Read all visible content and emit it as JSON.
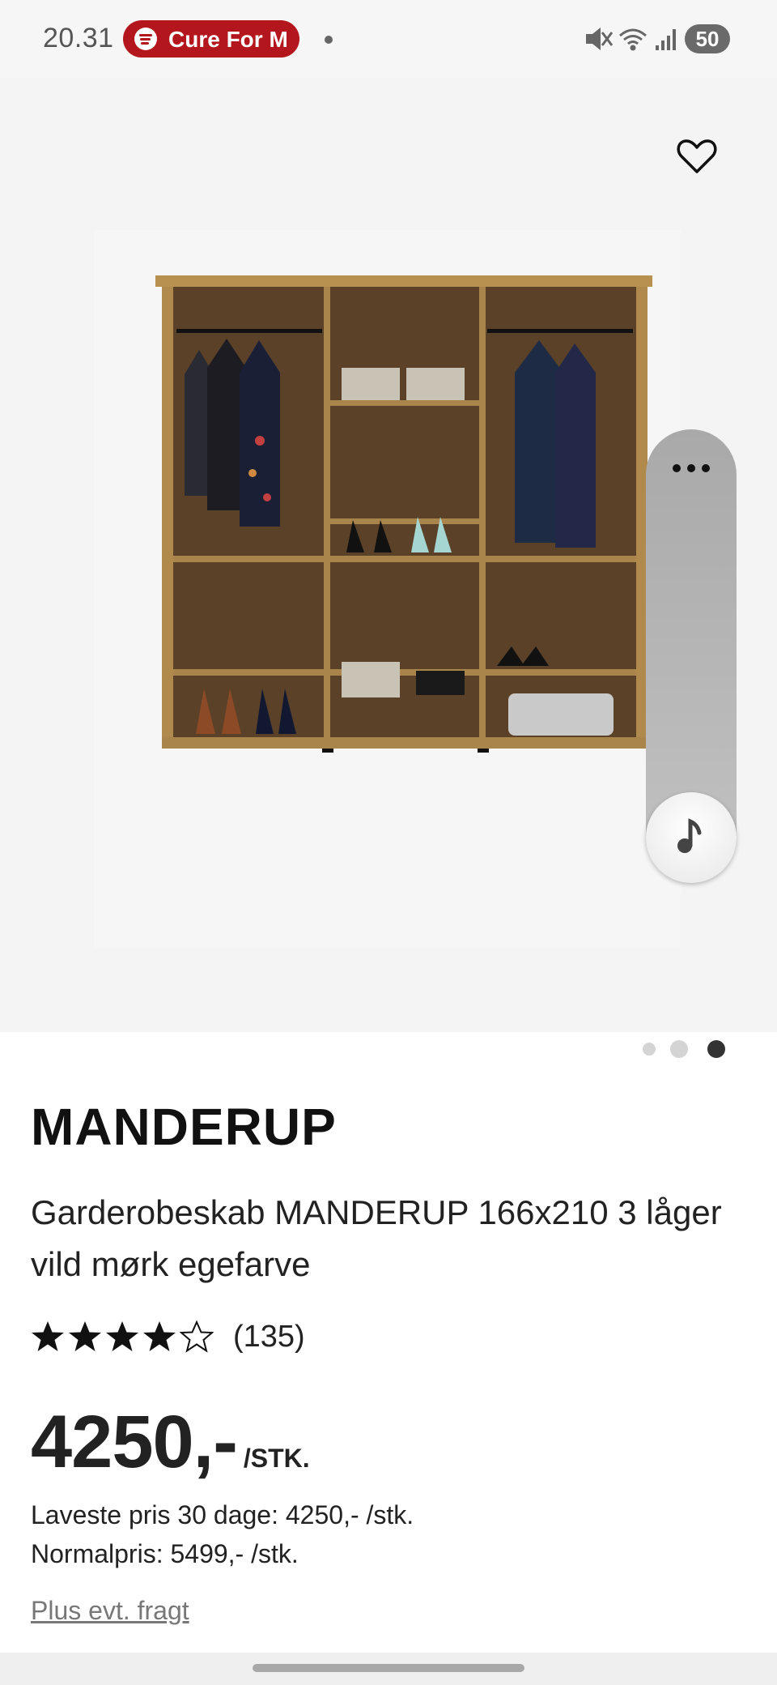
{
  "status_bar": {
    "time": "20.31",
    "media_app": "Spotify",
    "media_title": "Cure For M",
    "battery": "50",
    "icons": [
      "mute-icon",
      "wifi-icon",
      "signal-icon",
      "battery-icon"
    ]
  },
  "gallery": {
    "wishlist_icon": "heart-outline-icon",
    "image_subject": "wardrobe",
    "slide_count": 3,
    "active_slide": 3
  },
  "floating_widget": {
    "more_icon": "more-horizontal-icon",
    "music_icon": "music-note-icon"
  },
  "product": {
    "brand": "MANDERUP",
    "description": "Garderobeskab MANDERUP 166x210 3 låger vild mørk egefarve",
    "rating": 4,
    "rating_max": 5,
    "review_count": "(135)",
    "price": "4250,-",
    "price_unit": "/STK.",
    "lowest_price": "Laveste pris 30 dage: 4250,- /stk.",
    "normal_price": "Normalpris: 5499,- /stk.",
    "freight_link": "Plus evt. fragt"
  },
  "colors": {
    "spotify_pill": "#b3161c",
    "star": "#111111",
    "link": "#777777"
  }
}
